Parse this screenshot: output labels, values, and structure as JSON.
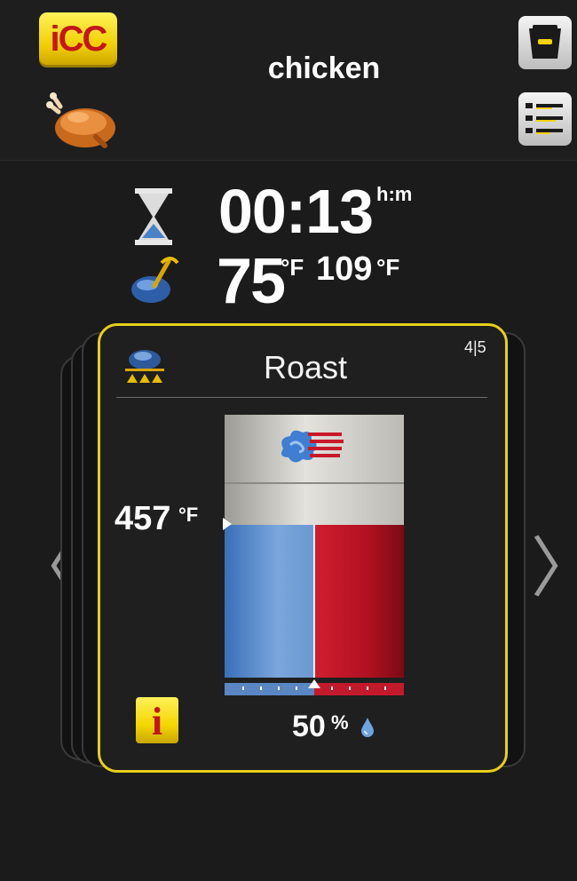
{
  "header": {
    "logo_text": "iCC",
    "title": "chicken"
  },
  "status": {
    "time_value": "00:13",
    "time_unit": "h:m",
    "core_temp": "75",
    "core_temp_unit": "°F",
    "set_core_temp": "109",
    "set_core_temp_unit": "°F"
  },
  "step": {
    "name": "Roast",
    "index": "4|5",
    "cabinet_temp": "457",
    "cabinet_temp_unit": "°F",
    "humidity": "50",
    "humidity_unit": "%",
    "humidity_level": 0.5,
    "info_label": "i"
  },
  "nav": {
    "prev": "〈",
    "next": "〉"
  },
  "colors": {
    "accent_yellow": "#e6cf1a",
    "dry_blue": "#5a86c4",
    "humid_red": "#c21a2b"
  }
}
